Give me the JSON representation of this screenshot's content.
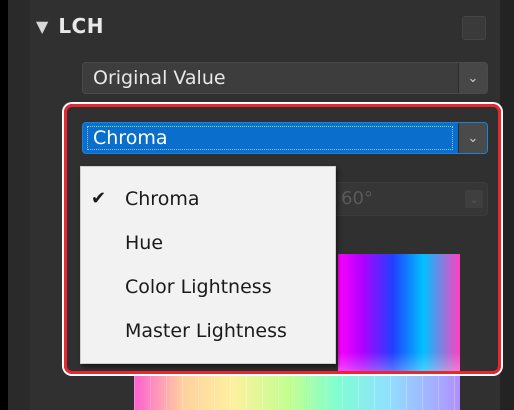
{
  "section": {
    "collapse_icon": "triangle-down-icon",
    "title": "LCH"
  },
  "original_value_select": {
    "value": "Original Value",
    "arrow_icon": "chevron-down-icon"
  },
  "chroma_select": {
    "value": "Chroma",
    "arrow_icon": "chevron-down-icon",
    "selected_color": "#0a6fcc"
  },
  "hidden_select": {
    "partial_value": "60°"
  },
  "dropdown": {
    "items": [
      {
        "label": "Chroma",
        "check": "✔"
      },
      {
        "label": "Hue",
        "check": ""
      },
      {
        "label": "Color Lightness",
        "check": ""
      },
      {
        "label": "Master Lightness",
        "check": ""
      }
    ]
  },
  "highlight_color": "#e8282e"
}
